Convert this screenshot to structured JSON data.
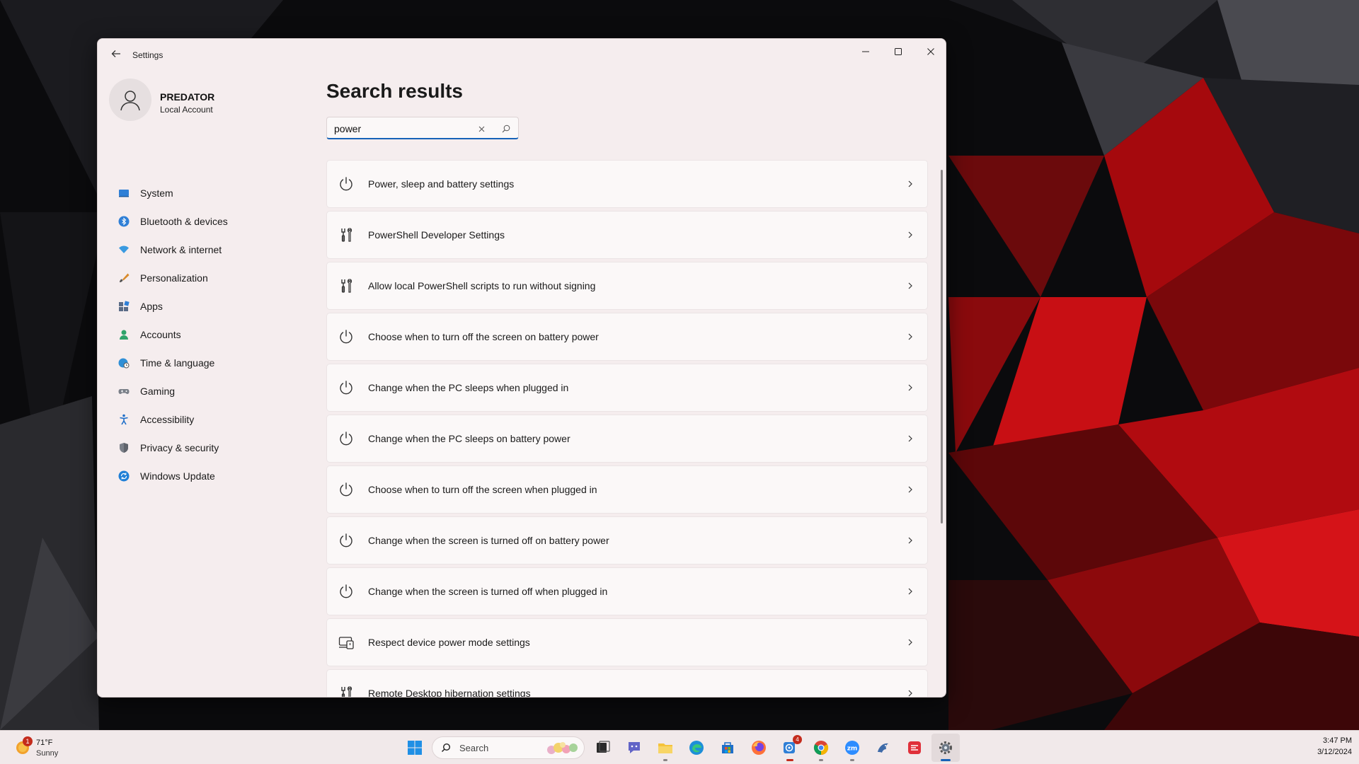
{
  "window": {
    "app_title": "Settings",
    "controls": [
      "minimize",
      "maximize",
      "close"
    ]
  },
  "profile": {
    "name": "PREDATOR",
    "subtitle": "Local Account"
  },
  "sidebar": {
    "items": [
      {
        "label": "System",
        "icon": "system-icon",
        "color": "#2f7fd6"
      },
      {
        "label": "Bluetooth & devices",
        "icon": "bluetooth-icon",
        "color": "#2f7fd6"
      },
      {
        "label": "Network & internet",
        "icon": "wifi-icon",
        "color": "#3a9ae0"
      },
      {
        "label": "Personalization",
        "icon": "brush-icon",
        "color": "#d98a2b"
      },
      {
        "label": "Apps",
        "icon": "apps-icon",
        "color": "#5a6b86"
      },
      {
        "label": "Accounts",
        "icon": "accounts-icon",
        "color": "#2fa36b"
      },
      {
        "label": "Time & language",
        "icon": "globe-clock-icon",
        "color": "#2f8fd6"
      },
      {
        "label": "Gaming",
        "icon": "gamepad-icon",
        "color": "#7a7f88"
      },
      {
        "label": "Accessibility",
        "icon": "accessibility-icon",
        "color": "#1f6fc9"
      },
      {
        "label": "Privacy & security",
        "icon": "shield-icon",
        "color": "#7a7f88"
      },
      {
        "label": "Windows Update",
        "icon": "update-icon",
        "color": "#1f7fd6"
      }
    ]
  },
  "main": {
    "title": "Search results",
    "search": {
      "value": "power",
      "placeholder": ""
    },
    "results": [
      {
        "label": "Power, sleep and battery settings",
        "icon": "power-icon"
      },
      {
        "label": "PowerShell Developer Settings",
        "icon": "developer-tools-icon"
      },
      {
        "label": "Allow local PowerShell scripts to run without signing",
        "icon": "developer-tools-icon"
      },
      {
        "label": "Choose when to turn off the screen on battery power",
        "icon": "power-icon"
      },
      {
        "label": "Change when the PC sleeps when plugged in",
        "icon": "power-icon"
      },
      {
        "label": "Change when the PC sleeps on battery power",
        "icon": "power-icon"
      },
      {
        "label": "Choose when to turn off the screen when plugged in",
        "icon": "power-icon"
      },
      {
        "label": "Change when the screen is turned off on battery power",
        "icon": "power-icon"
      },
      {
        "label": "Change when the screen is turned off when plugged in",
        "icon": "power-icon"
      },
      {
        "label": "Respect device power mode settings",
        "icon": "device-power-mode-icon"
      },
      {
        "label": "Remote Desktop hibernation settings",
        "icon": "developer-tools-icon"
      }
    ]
  },
  "taskbar": {
    "weather": {
      "temp": "71°F",
      "condition": "Sunny",
      "badge": "1"
    },
    "search_label": "Search",
    "apps": [
      {
        "name": "start-button",
        "icon": "windows-logo-icon"
      },
      {
        "name": "task-view-button",
        "icon": "task-view-icon"
      },
      {
        "name": "chat-button",
        "icon": "chat-icon"
      },
      {
        "name": "file-explorer-button",
        "icon": "folder-icon"
      },
      {
        "name": "edge-button",
        "icon": "edge-icon"
      },
      {
        "name": "store-button",
        "icon": "store-icon"
      },
      {
        "name": "firefox-button",
        "icon": "firefox-icon"
      },
      {
        "name": "teams-button",
        "icon": "teams-icon",
        "badge": "4"
      },
      {
        "name": "chrome-button",
        "icon": "chrome-icon"
      },
      {
        "name": "zoom-button",
        "icon": "zoom-icon"
      },
      {
        "name": "app-bird-button",
        "icon": "bird-icon"
      },
      {
        "name": "app-red-button",
        "icon": "red-app-icon"
      },
      {
        "name": "settings-button",
        "icon": "gear-icon"
      }
    ],
    "clock": {
      "time": "3:47 PM",
      "date": "3/12/2024"
    }
  },
  "colors": {
    "accent": "#1662b8",
    "window_bg": "#f5edee",
    "card_bg": "#fbf8f8",
    "badge_red": "#c42b1c"
  }
}
